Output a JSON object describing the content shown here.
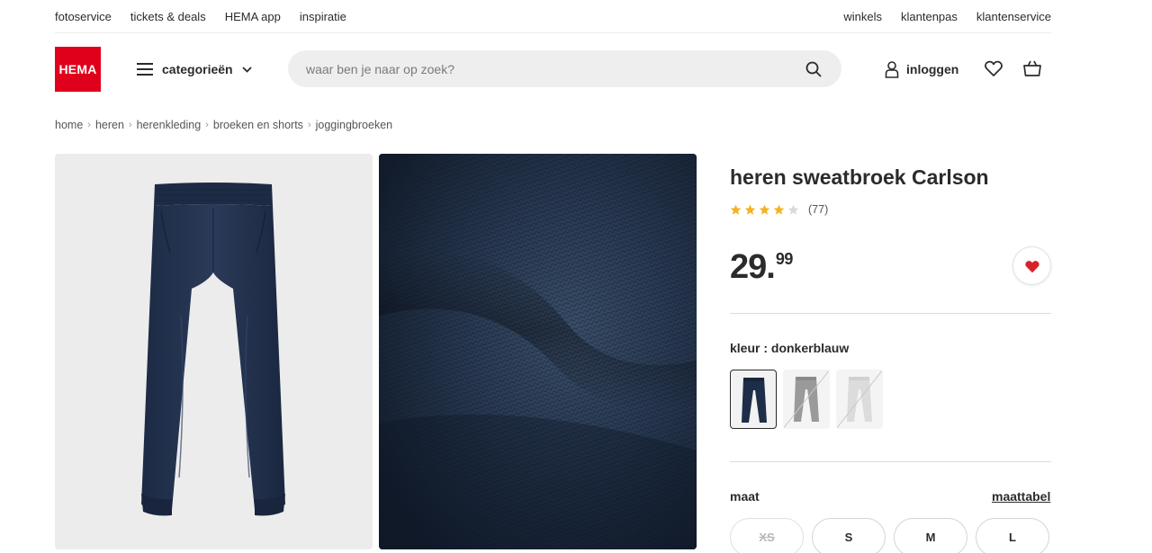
{
  "topbar": {
    "left_links": [
      "fotoservice",
      "tickets & deals",
      "HEMA app",
      "inspiratie"
    ],
    "right_links": [
      "winkels",
      "klantenpas",
      "klantenservice"
    ]
  },
  "header": {
    "logo_text": "HEMA",
    "logo_color": "#e0001b",
    "categories_label": "categorieën",
    "search_placeholder": "waar ben je naar op zoek?",
    "login_label": "inloggen"
  },
  "breadcrumb": [
    "home",
    "heren",
    "herenkleding",
    "broeken en shorts",
    "joggingbroeken"
  ],
  "product": {
    "title": "heren sweatbroek Carlson",
    "rating_stars": 4,
    "rating_max": 5,
    "review_count": "(77)",
    "price_int": "29.",
    "price_dec": "99",
    "color_label": "kleur : donkerblauw",
    "swatches": [
      {
        "name": "donkerblauw",
        "color": "#1f2e48",
        "available": true,
        "selected": true
      },
      {
        "name": "grijs",
        "color": "#9a9a9a",
        "available": false,
        "selected": false
      },
      {
        "name": "lichtgrijs",
        "color": "#dcdcdc",
        "available": false,
        "selected": false
      }
    ],
    "size_label": "maat",
    "size_chart_label": "maattabel",
    "sizes": [
      {
        "label": "XS",
        "available": false
      },
      {
        "label": "S",
        "available": true
      },
      {
        "label": "M",
        "available": true
      },
      {
        "label": "L",
        "available": true
      }
    ]
  },
  "colors": {
    "accent_red": "#e0001b",
    "star": "#f5b11e",
    "star_empty": "#d9d9d9",
    "heart": "#d9212a"
  }
}
